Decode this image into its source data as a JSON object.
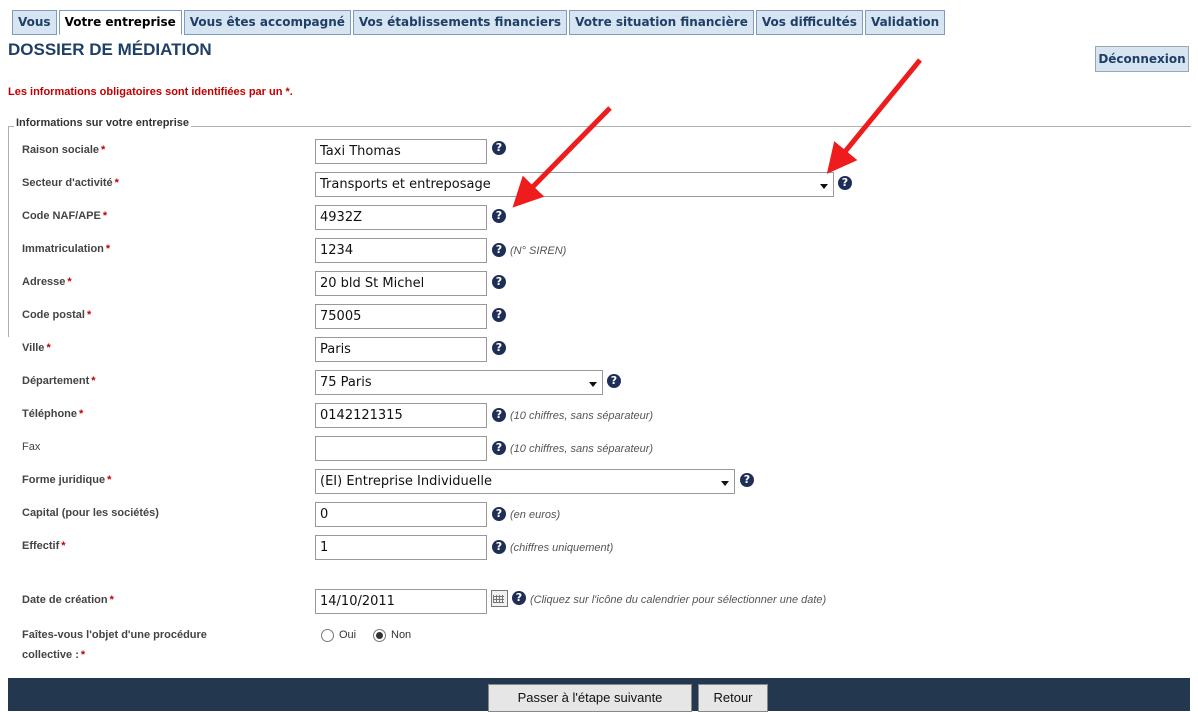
{
  "tabs": [
    {
      "label": "Vous",
      "active": false
    },
    {
      "label": "Votre entreprise",
      "active": true
    },
    {
      "label": "Vous êtes accompagné",
      "active": false
    },
    {
      "label": "Vos établissements financiers",
      "active": false
    },
    {
      "label": "Votre situation financière",
      "active": false
    },
    {
      "label": "Vos difficultés",
      "active": false
    },
    {
      "label": "Validation",
      "active": false
    }
  ],
  "page_title": "DOSSIER DE MÉDIATION",
  "logout_label": "Déconnexion",
  "mandatory_note": "Les informations obligatoires sont identifiées par un *.",
  "section_legend": "Informations sur votre entreprise",
  "required_mark": "*",
  "help_glyph": "?",
  "fields": {
    "raison_sociale": {
      "label": "Raison sociale",
      "value": "Taxi Thomas"
    },
    "secteur": {
      "label": "Secteur d'activité",
      "value": "Transports et entreposage"
    },
    "code_naf": {
      "label": "Code NAF/APE",
      "value": "4932Z"
    },
    "immatriculation": {
      "label": "Immatriculation",
      "value": "1234",
      "hint": "(N° SIREN)"
    },
    "adresse": {
      "label": "Adresse",
      "value": "20 bld St Michel"
    },
    "code_postal": {
      "label": "Code postal",
      "value": "75005"
    },
    "ville": {
      "label": "Ville",
      "value": "Paris"
    },
    "departement": {
      "label": "Département",
      "value": "75 Paris"
    },
    "telephone": {
      "label": "Téléphone",
      "value": "0142121315",
      "hint": "(10 chiffres, sans séparateur)"
    },
    "fax": {
      "label": "Fax",
      "value": "",
      "hint": "(10 chiffres, sans séparateur)"
    },
    "forme_juridique": {
      "label": "Forme juridique",
      "value": "(EI) Entreprise Individuelle"
    },
    "capital": {
      "label": "Capital (pour les sociétés)",
      "value": "0",
      "hint": "(en euros)"
    },
    "effectif": {
      "label": "Effectif",
      "value": "1",
      "hint": "(chiffres uniquement)"
    },
    "date_creation": {
      "label": "Date de création",
      "value": "14/10/2011",
      "hint": "(Cliquez sur l'icône du calendrier pour sélectionner une date)"
    },
    "procedure": {
      "label_line1": "Faîtes-vous l'objet d'une procédure",
      "label_line2": "collective :",
      "options": [
        "Oui",
        "Non"
      ],
      "selected": "Non"
    }
  },
  "buttons": {
    "next": "Passer à l'étape suivante",
    "back": "Retour"
  },
  "colors": {
    "tab_bg": "#d7e4f2",
    "title": "#1f3f66",
    "required": "#c00000",
    "help_icon": "#1f2e57",
    "bottom_bar": "#23384f",
    "annotation_arrow": "#ee1c1c"
  }
}
